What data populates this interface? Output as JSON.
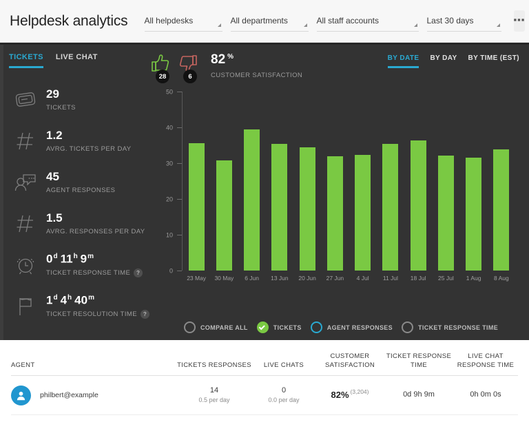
{
  "header": {
    "title": "Helpdesk analytics",
    "filters": [
      {
        "label": "All helpdesks",
        "icon": "chevron-down-icon"
      },
      {
        "label": "All departments",
        "icon": "chevron-down-icon"
      },
      {
        "label": "All staff accounts",
        "icon": "chevron-down-icon"
      },
      {
        "label": "Last 30 days",
        "icon": "chevron-down-icon"
      }
    ],
    "more_label": "▪▪▪"
  },
  "tabs": [
    {
      "label": "TICKETS",
      "active": true
    },
    {
      "label": "LIVE CHAT",
      "active": false
    }
  ],
  "metrics": [
    {
      "icon": "ticket-icon",
      "value": "29",
      "label": "TICKETS",
      "help": false
    },
    {
      "icon": "hash-icon",
      "value": "1.2",
      "label": "AVRG. TICKETS PER DAY",
      "help": false
    },
    {
      "icon": "agent-chat-icon",
      "value": "45",
      "label": "AGENT RESPONSES",
      "help": false
    },
    {
      "icon": "hash-icon",
      "value": "1.5",
      "label": "AVRG. RESPONSES PER DAY",
      "help": false
    },
    {
      "icon": "alarm-clock-icon",
      "value": "0d 11h 9m",
      "label": "TICKET RESPONSE TIME",
      "help": true,
      "help_label": "?"
    },
    {
      "icon": "flag-icon",
      "value": "1d 4h 40m",
      "label": "TICKET RESOLUTION TIME",
      "help": true,
      "help_label": "?"
    }
  ],
  "metric_time_parts": [
    {
      "index": 4,
      "parts": [
        {
          "n": "0",
          "u": "d"
        },
        {
          "n": "11",
          "u": "h"
        },
        {
          "n": "9",
          "u": "m"
        }
      ]
    },
    {
      "index": 5,
      "parts": [
        {
          "n": "1",
          "u": "d"
        },
        {
          "n": "4",
          "u": "h"
        },
        {
          "n": "40",
          "u": "m"
        }
      ]
    }
  ],
  "satisfaction": {
    "thumbs_up_icon": "thumbs-up-icon",
    "thumbs_down_icon": "thumbs-down-icon",
    "thumbs_up_count": "28",
    "thumbs_down_count": "6",
    "percent": "82",
    "percent_unit": "%",
    "label": "CUSTOMER SATISFACTION"
  },
  "view_tabs": [
    {
      "label": "BY DATE",
      "active": true
    },
    {
      "label": "BY DAY",
      "active": false
    },
    {
      "label": "BY TIME (EST)",
      "active": false
    }
  ],
  "legend": [
    {
      "label": "COMPARE ALL",
      "state": "off",
      "color": "#8a8a8a"
    },
    {
      "label": "TICKETS",
      "state": "selected",
      "color": "#7ac943"
    },
    {
      "label": "AGENT RESPONSES",
      "state": "outline",
      "color": "#2aa9d1"
    },
    {
      "label": "TICKET RESPONSE TIME",
      "state": "off",
      "color": "#8a8a8a"
    }
  ],
  "chart_data": {
    "type": "bar",
    "title": "",
    "xlabel": "",
    "ylabel": "",
    "ylim": [
      0,
      50
    ],
    "yticks": [
      0,
      10,
      20,
      30,
      40,
      50
    ],
    "grid": false,
    "legend_position": "bottom",
    "series_name": "Tickets",
    "bar_color": "#7ac943",
    "categories": [
      "23 May",
      "30 May",
      "6 Jun",
      "13 Jun",
      "20 Jun",
      "27 Jun",
      "4 Jul",
      "11 Jul",
      "18 Jul",
      "25 Jul",
      "1 Aug",
      "8 Aug"
    ],
    "values": [
      35.5,
      30.7,
      39.5,
      35.3,
      34.5,
      32.0,
      32.3,
      35.4,
      36.4,
      32.1,
      31.5,
      33.8
    ]
  },
  "table": {
    "columns": [
      "AGENT",
      "TICKETS RESPONSES",
      "LIVE CHATS",
      "CUSTOMER SATISFACTION",
      "TICKET RESPONSE TIME",
      "LIVE CHAT RESPONSE TIME"
    ],
    "rows": [
      {
        "avatar_icon": "user-avatar-icon",
        "agent": "philbert@example",
        "tickets_responses": "14",
        "tickets_responses_sub": "0.5 per day",
        "live_chats": "0",
        "live_chats_sub": "0.0 per day",
        "satisfaction": "82%",
        "satisfaction_count": "(3,204)",
        "ticket_response_time": "0d 9h 9m",
        "live_chat_response_time": "0h 0m 0s"
      }
    ]
  },
  "colors": {
    "accent": "#2aa9d1",
    "bar_green": "#7ac943",
    "dark_bg": "#333333",
    "thumb_up": "#7ac943",
    "thumb_down": "#c5645f",
    "avatar_blue": "#2196cf"
  }
}
